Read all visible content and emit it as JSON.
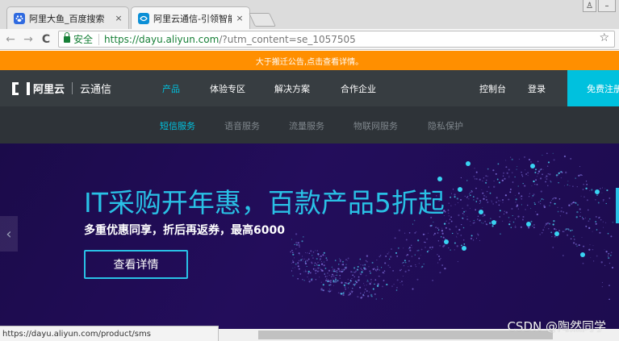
{
  "browser": {
    "tabs": [
      {
        "title": "阿里大鱼_百度搜索",
        "close": "×"
      },
      {
        "title": "阿里云通信-引领智能与",
        "close": "×"
      }
    ],
    "window_controls": [
      "♙",
      "–"
    ],
    "nav": {
      "back": "←",
      "forward": "→",
      "reload": "C"
    },
    "address": {
      "secure_label": "安全",
      "url_host": "https://dayu.aliyun.com",
      "url_path": "/?utm_content=se_1057505"
    },
    "bookmark_star": "☆",
    "status_url": "https://dayu.aliyun.com/product/sms"
  },
  "notice": {
    "text": "大于搬迁公告,点击查看详情。"
  },
  "header": {
    "logo_text": "阿里云",
    "product_name": "云通信",
    "nav": [
      "产品",
      "体验专区",
      "解决方案",
      "合作企业"
    ],
    "console": "控制台",
    "login": "登录",
    "signup": "免费注册"
  },
  "subnav": [
    "短信服务",
    "语音服务",
    "流量服务",
    "物联网服务",
    "隐私保护"
  ],
  "hero": {
    "title": "IT采购开年惠，百款产品5折起",
    "subtitle": "多重优惠同享，折后再返券，最高6000",
    "cta": "查看详情",
    "prev_arrow": "‹"
  },
  "watermark": "CSDN @陶然同学",
  "colors": {
    "notice_bg": "#ff8f00",
    "nav_bg": "#373d41",
    "subnav_bg": "#2e3338",
    "accent": "#00c1de",
    "hero_bg": "#1d0c4f",
    "hero_title": "#29c1e6"
  }
}
